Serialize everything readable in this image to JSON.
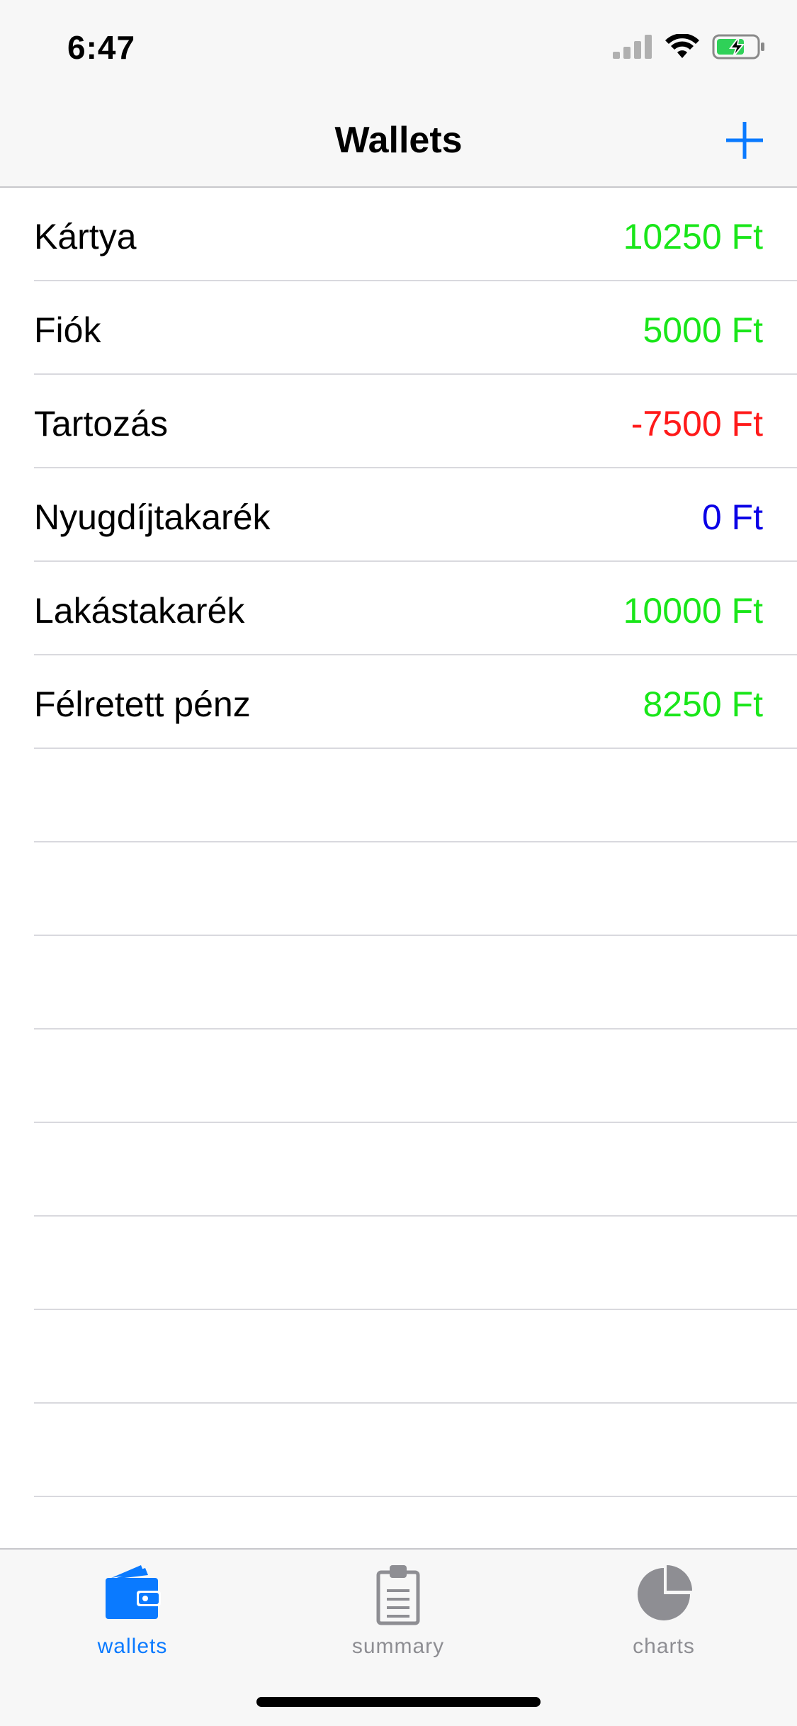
{
  "status_bar": {
    "time": "6:47"
  },
  "nav": {
    "title": "Wallets"
  },
  "wallets": [
    {
      "name": "Kártya",
      "amount": "10250 Ft",
      "color": "#19e619"
    },
    {
      "name": "Fiók",
      "amount": "5000 Ft",
      "color": "#19e619"
    },
    {
      "name": "Tartozás",
      "amount": "-7500 Ft",
      "color": "#ff1a1a"
    },
    {
      "name": "Nyugdíjtakarék",
      "amount": "0 Ft",
      "color": "#0a00e6"
    },
    {
      "name": "Lakástakarék",
      "amount": "10000 Ft",
      "color": "#19e619"
    },
    {
      "name": "Félretett pénz",
      "amount": "8250 Ft",
      "color": "#19e619"
    }
  ],
  "tabbar": {
    "tabs": [
      {
        "label": "wallets",
        "icon": "wallet-icon",
        "active": true
      },
      {
        "label": "summary",
        "icon": "clipboard-icon",
        "active": false
      },
      {
        "label": "charts",
        "icon": "pie-chart-icon",
        "active": false
      }
    ]
  },
  "colors": {
    "accent": "#0a7aff",
    "inactive": "#8e8e93"
  }
}
